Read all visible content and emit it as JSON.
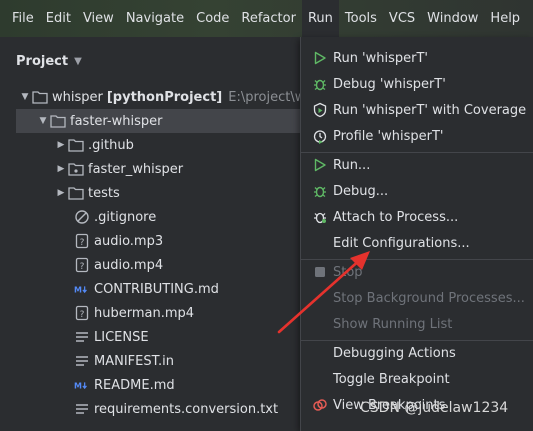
{
  "menubar": {
    "items": [
      "File",
      "Edit",
      "View",
      "Navigate",
      "Code",
      "Refactor",
      "Run",
      "Tools",
      "VCS",
      "Window",
      "Help"
    ]
  },
  "panel": {
    "title": "Project",
    "root": {
      "name": "whisper",
      "module": "[pythonProject]",
      "path": "E:\\project\\wh"
    },
    "tree": [
      {
        "name": "faster-whisper",
        "icon": "folder-icon"
      },
      {
        "name": ".github",
        "icon": "folder-icon"
      },
      {
        "name": "faster_whisper",
        "icon": "package-folder-icon"
      },
      {
        "name": "tests",
        "icon": "folder-icon"
      },
      {
        "name": ".gitignore",
        "icon": "ignore-file-icon"
      },
      {
        "name": "audio.mp3",
        "icon": "unknown-file-icon"
      },
      {
        "name": "audio.mp4",
        "icon": "unknown-file-icon"
      },
      {
        "name": "CONTRIBUTING.md",
        "icon": "markdown-icon"
      },
      {
        "name": "huberman.mp4",
        "icon": "unknown-file-icon"
      },
      {
        "name": "LICENSE",
        "icon": "text-file-icon"
      },
      {
        "name": "MANIFEST.in",
        "icon": "text-file-icon"
      },
      {
        "name": "README.md",
        "icon": "markdown-icon"
      },
      {
        "name": "requirements.conversion.txt",
        "icon": "text-file-icon"
      }
    ]
  },
  "run_menu": {
    "items": [
      {
        "label": "Run 'whisperT'",
        "icon": "run-icon",
        "enabled": true
      },
      {
        "label": "Debug 'whisperT'",
        "icon": "debug-icon",
        "enabled": true
      },
      {
        "label": "Run 'whisperT' with Coverage",
        "icon": "coverage-icon",
        "enabled": true
      },
      {
        "label": "Profile 'whisperT'",
        "icon": "profile-icon",
        "enabled": true
      },
      {
        "label": "Run...",
        "icon": "run-icon",
        "enabled": true
      },
      {
        "label": "Debug...",
        "icon": "debug-icon",
        "enabled": true
      },
      {
        "label": "Attach to Process...",
        "icon": "attach-icon",
        "enabled": true
      },
      {
        "label": "Edit Configurations...",
        "icon": "",
        "enabled": true
      },
      {
        "label": "Stop",
        "icon": "stop-icon",
        "enabled": false
      },
      {
        "label": "Stop Background Processes...",
        "icon": "",
        "enabled": false
      },
      {
        "label": "Show Running List",
        "icon": "",
        "enabled": false
      },
      {
        "label": "Debugging Actions",
        "icon": "",
        "enabled": true
      },
      {
        "label": "Toggle Breakpoint",
        "icon": "",
        "enabled": true
      },
      {
        "label": "View Breakpoints",
        "icon": "breakpoints-icon",
        "enabled": true
      }
    ]
  },
  "watermark": "CSDN @judelaw1234",
  "colors": {
    "accent_green": "#5fb865",
    "debug_green": "#5fb865",
    "arrow_red": "#e5322d",
    "selection": "#43454a",
    "markdown_blue": "#548af7"
  }
}
